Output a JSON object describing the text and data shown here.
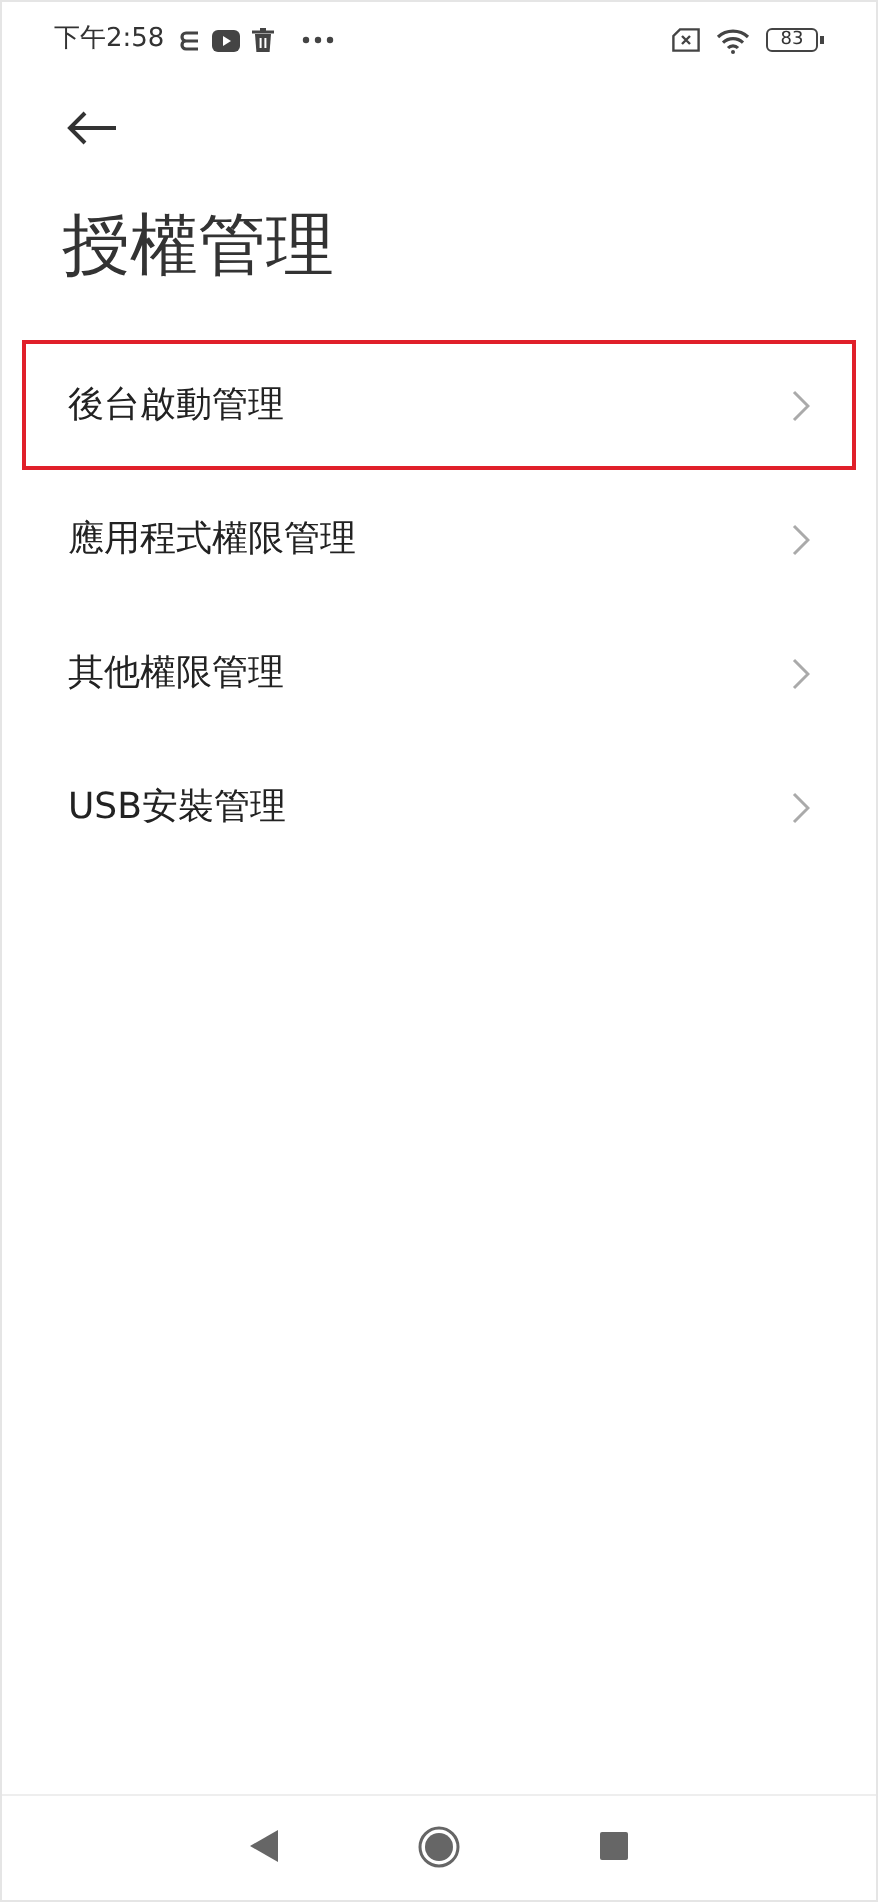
{
  "status_bar": {
    "time": "下午2:58",
    "battery": "83"
  },
  "title": "授權管理",
  "items": [
    {
      "label": "後台啟動管理",
      "highlighted": true
    },
    {
      "label": "應用程式權限管理",
      "highlighted": false
    },
    {
      "label": "其他權限管理",
      "highlighted": false
    },
    {
      "label": "USB安裝管理",
      "highlighted": false
    }
  ]
}
